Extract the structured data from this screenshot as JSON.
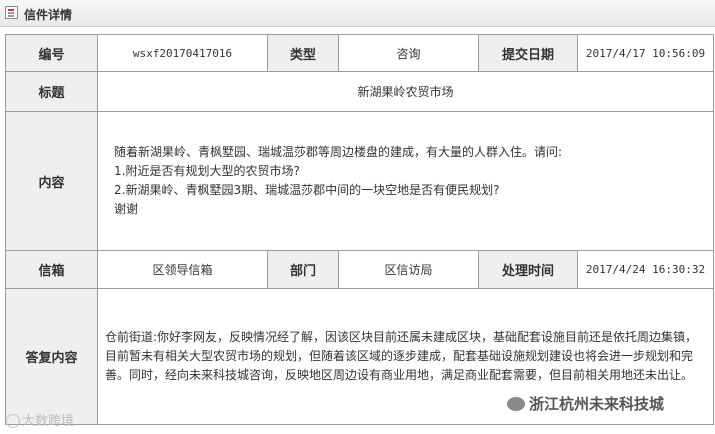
{
  "panel": {
    "title": "信件详情",
    "icon": "document-icon"
  },
  "table": {
    "row1": {
      "id_label": "编号",
      "id_value": "wsxf20170417016",
      "type_label": "类型",
      "type_value": "咨询",
      "date_label": "提交日期",
      "date_value": "2017/4/17 10:56:09"
    },
    "row2": {
      "title_label": "标题",
      "title_value": "新湖果岭农贸市场"
    },
    "row3": {
      "content_label": "内容",
      "content_lines": [
        "随着新湖果岭、青枫墅园、瑞城温莎郡等周边楼盘的建成，有大量的人群入住。请问:",
        "1.附近是否有规划大型的农贸市场?",
        "2.新湖果岭、青枫墅园3期、瑞城温莎郡中间的一块空地是否有便民规划?",
        "谢谢"
      ]
    },
    "row4": {
      "mailbox_label": "信箱",
      "mailbox_value": "区领导信箱",
      "dept_label": "部门",
      "dept_value": "区信访局",
      "handled_label": "处理时间",
      "handled_value": "2017/4/24 16:30:32"
    },
    "row5": {
      "reply_label": "答复内容",
      "reply_text": "仓前街道:你好李网友，反映情况经了解，因该区块目前还属未建成区块，基础配套设施目前还是依托周边集镇，目前暂未有相关大型农贸市场的规划，但随着该区域的逐步建成，配套基础设施规划建设也将会进一步规划和完善。同时，经向未来科技城咨询，反映地区周边设有商业用地，满足商业配套需要，但目前相关用地还未出让。"
    }
  },
  "watermarks": {
    "left": "大数跨境",
    "right": "浙江杭州未来科技城"
  }
}
